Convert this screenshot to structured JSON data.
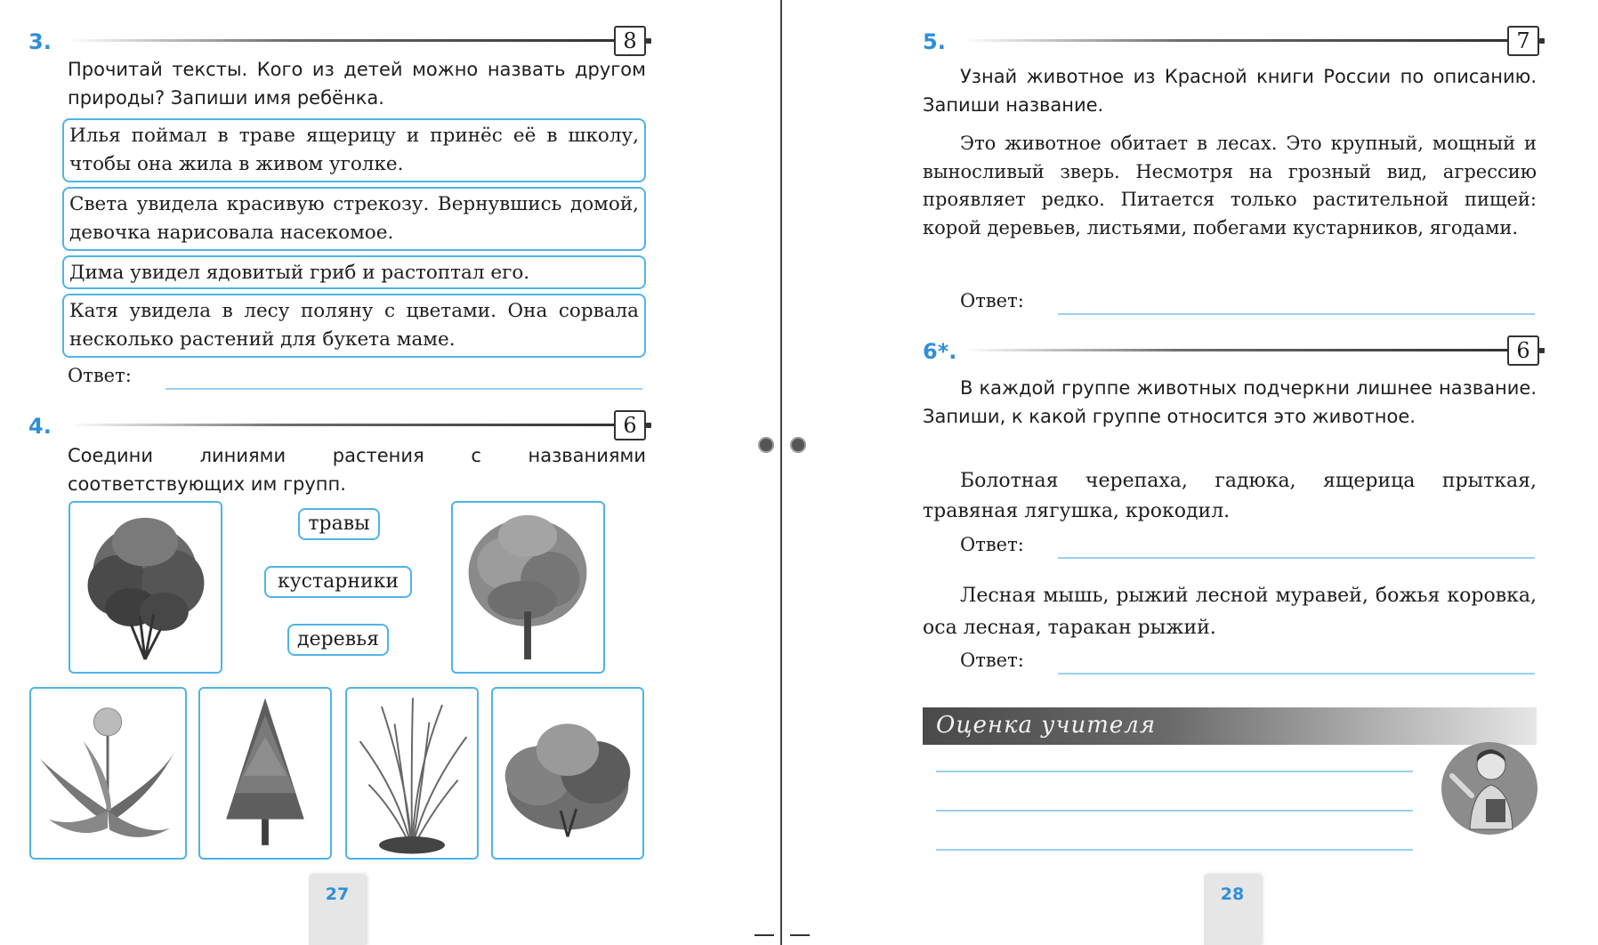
{
  "left_page": {
    "page_number": "27",
    "task3": {
      "number": "3.",
      "score": "8",
      "prompt": "Прочитай тексты. Кого из детей можно назвать другом природы? Запиши имя ребёнка.",
      "texts": [
        "Илья поймал в траве ящерицу и принёс её в школу, чтобы она жила в живом уголке.",
        "Света увидела красивую стрекозу. Вернувшись домой, девочка нарисовала насекомое.",
        "Дима увидел ядовитый гриб и растоптал его.",
        "Катя увидела в лесу поляну с цветами. Она сорвала несколько растений для букета маме."
      ],
      "answer_label": "Ответ:"
    },
    "task4": {
      "number": "4.",
      "score": "6",
      "prompt": "Соедини линиями растения с названиями соответствующих им групп.",
      "groups": [
        "травы",
        "кустарники",
        "деревья"
      ]
    }
  },
  "right_page": {
    "page_number": "28",
    "task5": {
      "number": "5.",
      "score": "7",
      "prompt": "Узнай животное из Красной книги России по описанию. Запиши название.",
      "description": "Это животное обитает в лесах. Это крупный, мощный и выносливый зверь. Несмотря на грозный вид, агрессию проявляет редко. Питается только растительной пищей: корой деревьев, листьями, побегами кустарников, ягодами.",
      "answer_label": "Ответ:"
    },
    "task6": {
      "number": "6*.",
      "score": "6",
      "prompt": "В каждой группе животных подчеркни лишнее название. Запиши, к какой группе относится это животное.",
      "group1": "Болотная черепаха, гадюка, ящерица прыткая, травяная лягушка, крокодил.",
      "answer1_label": "Ответ:",
      "group2": "Лесная мышь, рыжий лесной муравей, божья коровка, оса лесная, таракан рыжий.",
      "answer2_label": "Ответ:"
    },
    "teacher_grade": {
      "label": "Оценка учителя"
    }
  },
  "colors": {
    "accent_blue": "#2f8fd8",
    "box_border": "#4fb4e6",
    "answer_line": "#9ccff0"
  }
}
